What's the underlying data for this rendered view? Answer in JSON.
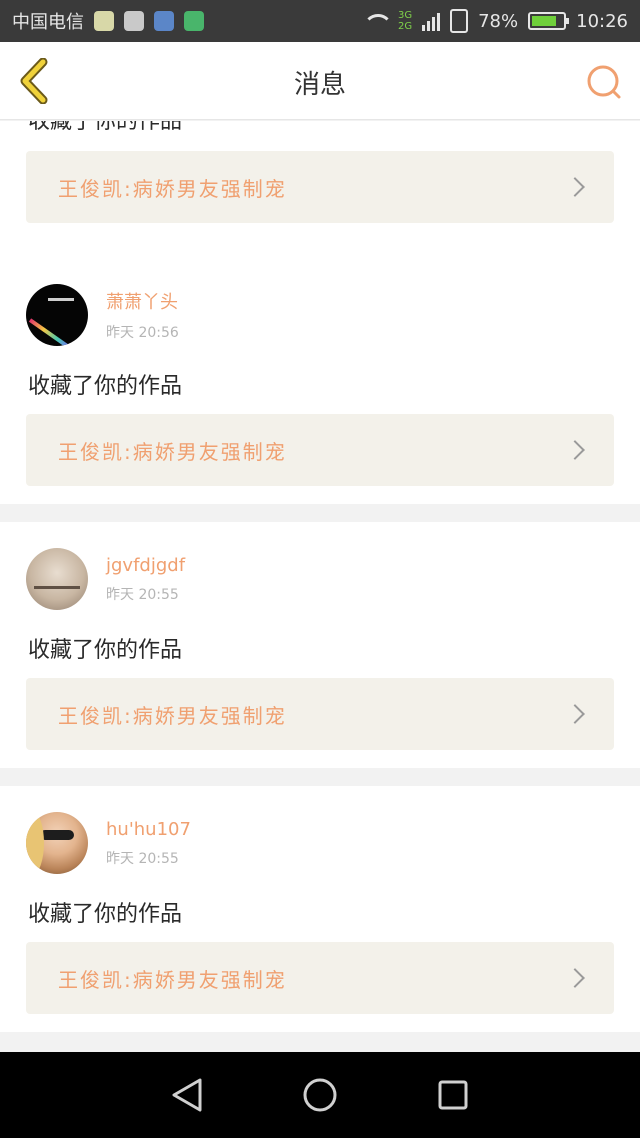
{
  "status_bar": {
    "carrier": "中国电信",
    "network_top": "3G",
    "network_bottom": "2G",
    "battery": "78%",
    "time": "10:26"
  },
  "header": {
    "title": "消息",
    "back_icon": "chevron-left-icon",
    "search_icon": "search-icon",
    "accent_color": "#f0a070"
  },
  "partial_item": {
    "action": "收藏了你的作品",
    "work_title": "王俊凯:病娇男友强制宠"
  },
  "items": [
    {
      "username": "萧萧丫头",
      "time": "昨天 20:56",
      "action": "收藏了你的作品",
      "work_title": "王俊凯:病娇男友强制宠"
    },
    {
      "username": "jgvfdjgdf",
      "time": "昨天 20:55",
      "action": "收藏了你的作品",
      "work_title": "王俊凯:病娇男友强制宠"
    },
    {
      "username": "hu'hu107",
      "time": "昨天 20:55",
      "action": "收藏了你的作品",
      "work_title": "王俊凯:病娇男友强制宠"
    }
  ]
}
